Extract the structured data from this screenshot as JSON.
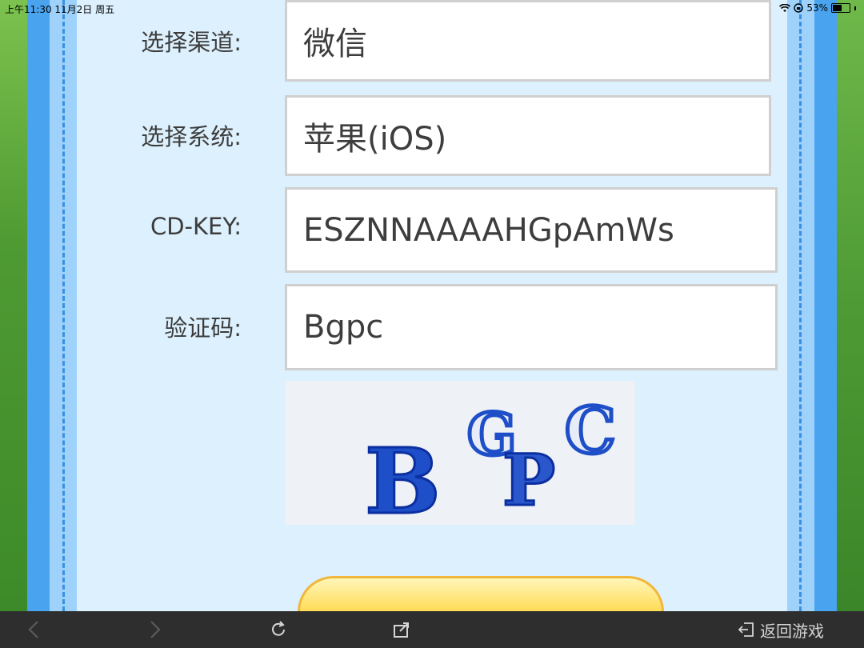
{
  "status_bar": {
    "time_date": "上午11:30  11月2日 周五",
    "battery": "53%"
  },
  "form": {
    "channel_label": "选择渠道:",
    "channel_value": "微信",
    "system_label": "选择系统:",
    "system_value": "苹果(iOS)",
    "cdkey_label": "CD-KEY:",
    "cdkey_value": "ESZNNAAAAHGpAmWs",
    "captcha_label": "验证码:",
    "captcha_value": "Bgpc",
    "captcha_image_text": "BGPC"
  },
  "toolbar": {
    "back_icon": "chevron-left-icon",
    "forward_icon": "chevron-right-icon",
    "reload_icon": "reload-icon",
    "share_icon": "share-icon",
    "return_game_label": "返回游戏"
  }
}
